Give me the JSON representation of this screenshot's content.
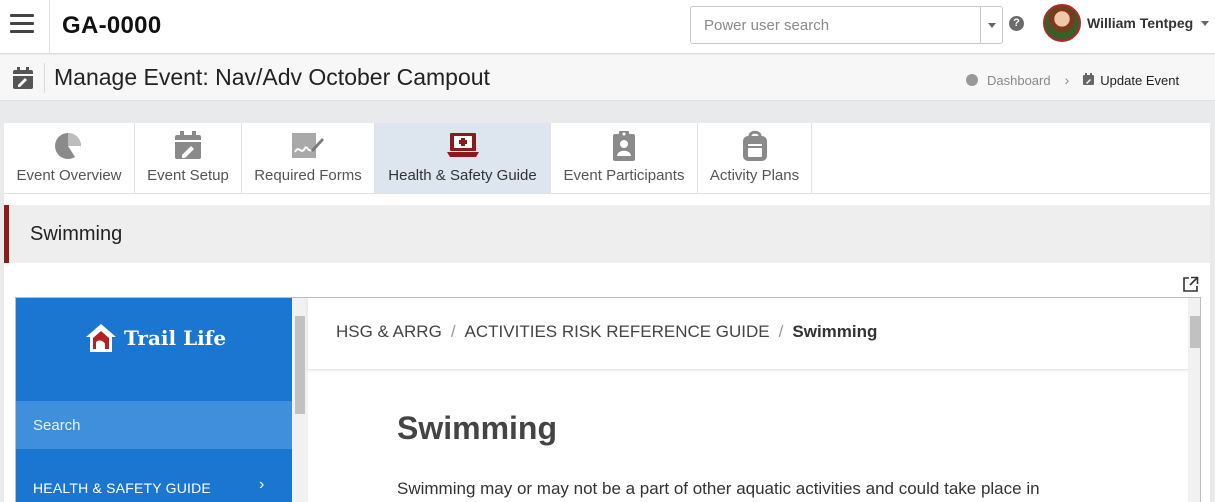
{
  "header": {
    "app_code": "GA-0000",
    "search_placeholder": "Power user search",
    "help_icon": "?",
    "user_name": "William Tentpeg"
  },
  "page": {
    "title": "Manage Event: Nav/Adv October Campout",
    "breadcrumb": {
      "dashboard": "Dashboard",
      "current": "Update Event"
    }
  },
  "tabs": [
    {
      "label": "Event Overview",
      "icon": "pie-chart-icon"
    },
    {
      "label": "Event Setup",
      "icon": "calendar-edit-icon"
    },
    {
      "label": "Required Forms",
      "icon": "signature-icon"
    },
    {
      "label": "Health & Safety Guide",
      "icon": "first-aid-laptop-icon",
      "active": true
    },
    {
      "label": "Event Participants",
      "icon": "clipboard-person-icon"
    },
    {
      "label": "Activity Plans",
      "icon": "backpack-icon"
    }
  ],
  "section": {
    "title": "Swimming"
  },
  "embedded": {
    "logo_text": "Trail Life",
    "search_label": "Search",
    "nav_item": "HEALTH & SAFETY GUIDE",
    "crumbs": [
      "HSG & ARRG",
      "ACTIVITIES RISK REFERENCE GUIDE",
      "Swimming"
    ],
    "doc_title": "Swimming",
    "doc_paragraph": "Swimming may or may not be a part of other aquatic activities and could take place in"
  },
  "colors": {
    "accent_red": "#8b1a1a",
    "sidebar_blue": "#1b76d2",
    "active_tab": "#dde5ee"
  }
}
